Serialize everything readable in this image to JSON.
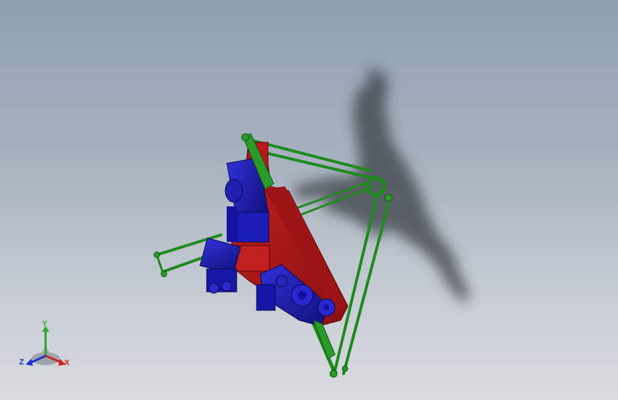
{
  "viewport": {
    "background_top": "#8fa0b2",
    "background_bottom": "#d9dce1"
  },
  "model": {
    "frame_color": "#b01818",
    "motor_color": "#1a1ab0",
    "arm_color": "#1e8a1e",
    "shadow_color": "#3a3f45"
  },
  "triad": {
    "x_label": "X",
    "y_label": "Y",
    "z_label": "Z",
    "x_color": "#d02020",
    "y_color": "#2aa52a",
    "z_color": "#2030c8"
  }
}
